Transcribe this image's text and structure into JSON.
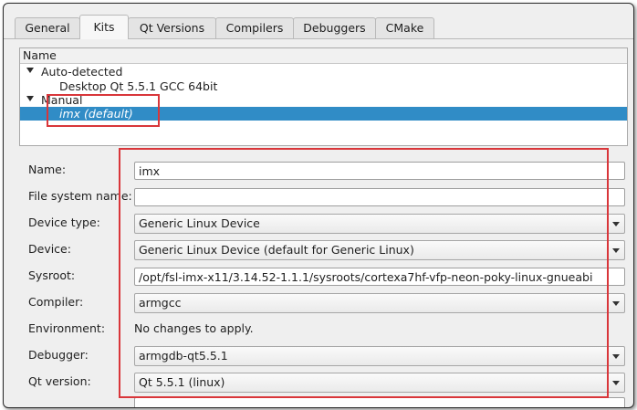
{
  "tabs": [
    {
      "label": "General",
      "active": false
    },
    {
      "label": "Kits",
      "active": true
    },
    {
      "label": "Qt Versions",
      "active": false
    },
    {
      "label": "Compilers",
      "active": false
    },
    {
      "label": "Debuggers",
      "active": false
    },
    {
      "label": "CMake",
      "active": false
    }
  ],
  "tree": {
    "header": "Name",
    "auto_group": "Auto-detected",
    "auto_item": "Desktop Qt 5.5.1 GCC 64bit",
    "manual_group": "Manual",
    "manual_item": "imx (default)"
  },
  "form": {
    "name_label": "Name:",
    "name_value": "imx",
    "fs_label": "File system name:",
    "fs_value": "",
    "device_type_label": "Device type:",
    "device_type_value": "Generic Linux Device",
    "device_label": "Device:",
    "device_value": "Generic Linux Device (default for Generic Linux)",
    "sysroot_label": "Sysroot:",
    "sysroot_value": "/opt/fsl-imx-x11/3.14.52-1.1.1/sysroots/cortexa7hf-vfp-neon-poky-linux-gnueabi",
    "compiler_label": "Compiler:",
    "compiler_value": "armgcc",
    "env_label": "Environment:",
    "env_value": "No changes to apply.",
    "debugger_label": "Debugger:",
    "debugger_value": "armgdb-qt5.5.1",
    "qt_label": "Qt version:",
    "qt_value": "Qt 5.5.1 (linux)"
  },
  "colors": {
    "selection": "#308cc6",
    "highlight": "#d9363a"
  },
  "icons": {
    "expand": "triangle-down-icon",
    "combo": "chevron-down-icon"
  }
}
